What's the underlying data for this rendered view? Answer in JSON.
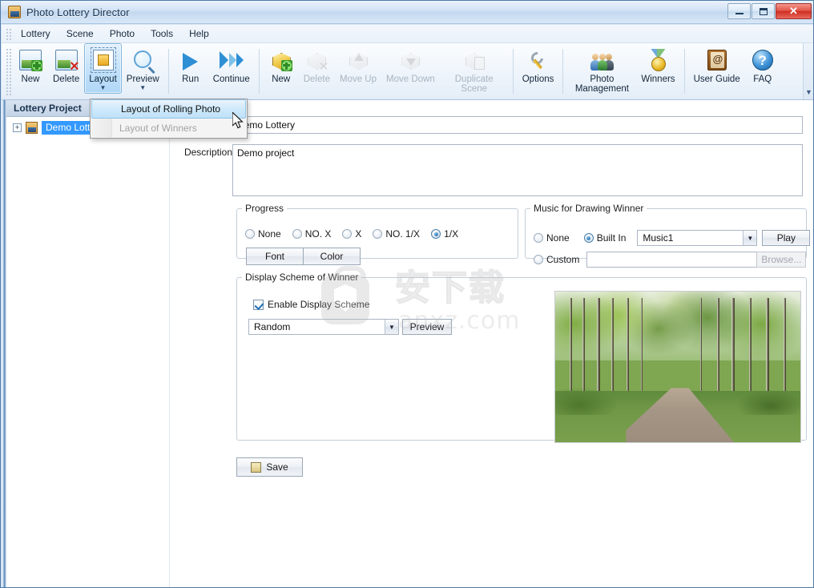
{
  "window": {
    "title": "Photo Lottery Director",
    "icon": "app-icon",
    "caption_buttons": [
      {
        "name": "minimize",
        "glyph": "–"
      },
      {
        "name": "maximize",
        "glyph": "□"
      },
      {
        "name": "close",
        "glyph": "✕"
      }
    ]
  },
  "menubar": {
    "items": [
      {
        "label": "Lottery"
      },
      {
        "label": "Scene"
      },
      {
        "label": "Photo"
      },
      {
        "label": "Tools"
      },
      {
        "label": "Help"
      }
    ]
  },
  "toolbar": {
    "scroll_icon": "chevron-down-icon",
    "groups": [
      {
        "name": "lottery-group",
        "buttons": [
          {
            "label": "New",
            "icon": "photo-new-icon",
            "state": "enabled",
            "dropdown": false
          },
          {
            "label": "Delete",
            "icon": "photo-delete-icon",
            "state": "enabled",
            "dropdown": false
          },
          {
            "label": "Layout",
            "icon": "layout-icon",
            "state": "active",
            "dropdown": true
          },
          {
            "label": "Preview",
            "icon": "magnifier-icon",
            "state": "enabled",
            "dropdown": true
          }
        ]
      },
      {
        "name": "run-group",
        "buttons": [
          {
            "label": "Run",
            "icon": "play-icon",
            "state": "enabled",
            "dropdown": false
          },
          {
            "label": "Continue",
            "icon": "fast-forward-icon",
            "state": "enabled",
            "dropdown": false
          }
        ]
      },
      {
        "name": "scene-group",
        "buttons": [
          {
            "label": "New",
            "icon": "cube-plus-icon",
            "state": "enabled",
            "dropdown": false
          },
          {
            "label": "Delete",
            "icon": "cube-delete-icon",
            "state": "disabled",
            "dropdown": false
          },
          {
            "label": "Move Up",
            "icon": "cube-up-icon",
            "state": "disabled",
            "dropdown": false
          },
          {
            "label": "Move Down",
            "icon": "cube-down-icon",
            "state": "disabled",
            "dropdown": false
          },
          {
            "label": "Duplicate Scene",
            "icon": "cube-duplicate-icon",
            "state": "disabled",
            "dropdown": false
          }
        ]
      },
      {
        "name": "options-group",
        "buttons": [
          {
            "label": "Options",
            "icon": "wrench-icon",
            "state": "enabled",
            "dropdown": false
          }
        ]
      },
      {
        "name": "manage-group",
        "buttons": [
          {
            "label": "Photo Management",
            "icon": "people-icon",
            "state": "enabled",
            "dropdown": false
          },
          {
            "label": "Winners",
            "icon": "medal-icon",
            "state": "enabled",
            "dropdown": false
          }
        ]
      },
      {
        "name": "help-group",
        "buttons": [
          {
            "label": "User Guide",
            "icon": "book-icon",
            "state": "enabled",
            "dropdown": false
          },
          {
            "label": "FAQ",
            "icon": "faq-icon",
            "state": "enabled",
            "dropdown": false
          }
        ]
      }
    ]
  },
  "dropdown": {
    "open": true,
    "items": [
      {
        "label": "Layout of Rolling Photo",
        "state": "selected"
      },
      {
        "label": "Layout of Winners",
        "state": "disabled"
      }
    ]
  },
  "sidebar": {
    "header": "Lottery Project",
    "tree": [
      {
        "label": "Demo Lottery",
        "expander": "+",
        "selected": true,
        "icon": "project-icon"
      }
    ]
  },
  "form": {
    "name_value": "Demo Lottery",
    "description_label": "Description",
    "description_value": "Demo project",
    "progress": {
      "legend": "Progress",
      "options": [
        {
          "label": "None",
          "selected": false
        },
        {
          "label": "NO. X",
          "selected": false
        },
        {
          "label": "X",
          "selected": false
        },
        {
          "label": "NO. 1/X",
          "selected": false
        },
        {
          "label": "1/X",
          "selected": true
        }
      ],
      "font_button": "Font",
      "color_button": "Color"
    },
    "music": {
      "legend": "Music for Drawing Winner",
      "none_label": "None",
      "none_selected": false,
      "builtin_label": "Built In",
      "builtin_selected": true,
      "builtin_value": "Music1",
      "play_button": "Play",
      "custom_label": "Custom",
      "custom_selected": false,
      "custom_value": "",
      "browse_button": "Browse..."
    },
    "display_scheme": {
      "legend": "Display Scheme of Winner",
      "enable_label": "Enable Display Scheme",
      "enable_checked": true,
      "scheme_value": "Random",
      "preview_button": "Preview"
    },
    "save_button": "Save"
  },
  "watermark": {
    "chinese": "安下载",
    "url": "anxz.com"
  },
  "colors": {
    "accent_blue": "#3399ff",
    "title_gradient_top": "#eaf2fb",
    "close_red": "#cf2f22",
    "ribbon_active": "#c4e2fa"
  }
}
